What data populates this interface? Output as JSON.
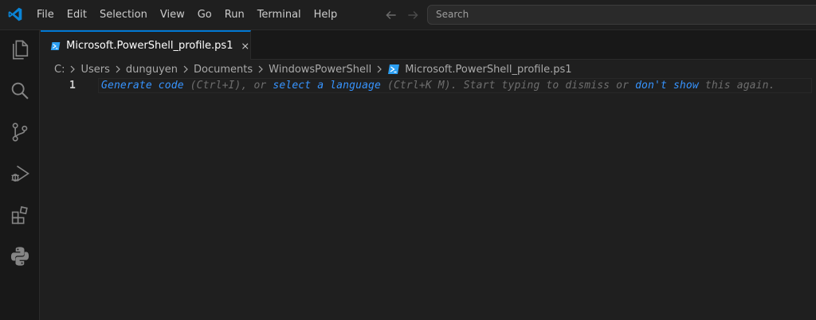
{
  "titlebar": {
    "menu": [
      "File",
      "Edit",
      "Selection",
      "View",
      "Go",
      "Run",
      "Terminal",
      "Help"
    ],
    "search_placeholder": "Search",
    "back_icon": "arrow-left-icon",
    "forward_icon": "arrow-right-icon"
  },
  "activitybar": {
    "items": [
      {
        "name": "explorer",
        "icon": "files-icon"
      },
      {
        "name": "search",
        "icon": "search-icon"
      },
      {
        "name": "source-control",
        "icon": "source-control-icon"
      },
      {
        "name": "run-and-debug",
        "icon": "run-debug-icon"
      },
      {
        "name": "extensions",
        "icon": "extensions-icon"
      },
      {
        "name": "python",
        "icon": "python-icon"
      }
    ]
  },
  "tab": {
    "label": "Microsoft.PowerShell_profile.ps1",
    "icon": "powershell-icon",
    "close_icon": "close-icon"
  },
  "breadcrumb": [
    "C:",
    "Users",
    "dunguyen",
    "Documents",
    "WindowsPowerShell",
    "Microsoft.PowerShell_profile.ps1"
  ],
  "editor": {
    "line_number": "1",
    "hint": {
      "generate": "Generate code",
      "ctrl_i": " (Ctrl+I), or ",
      "select_lang": "select a language",
      "ctrl_k": " (Ctrl+K M). Start typing to dismiss or ",
      "dont_show": "don't show",
      "tail": " this again."
    }
  },
  "colors": {
    "accent": "#0078d4",
    "link": "#3794ff",
    "background": "#1f1f1f",
    "activitybar": "#181818",
    "powershell": "#2c9ff2"
  }
}
